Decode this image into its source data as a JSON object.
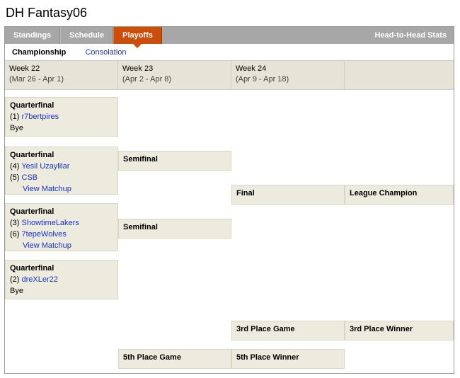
{
  "title": "DH Fantasy06",
  "topnav": {
    "standings": "Standings",
    "schedule": "Schedule",
    "playoffs": "Playoffs",
    "h2h": "Head-to-Head Stats"
  },
  "subnav": {
    "championship": "Championship",
    "consolation": "Consolation"
  },
  "weeks": {
    "w22_title": "Week 22",
    "w22_range": "(Mar 26 - Apr 1)",
    "w23_title": "Week 23",
    "w23_range": "(Apr 2 - Apr 8)",
    "w24_title": "Week 24",
    "w24_range": "(Apr 9 - Apr 18)"
  },
  "labels": {
    "quarterfinal": "Quarterfinal",
    "semifinal": "Semifinal",
    "final": "Final",
    "league_champion": "League Champion",
    "third_place_game": "3rd Place Game",
    "third_place_winner": "3rd Place Winner",
    "fifth_place_game": "5th Place Game",
    "fifth_place_winner": "5th Place Winner",
    "bye": "Bye",
    "view_matchup": "View Matchup"
  },
  "qf1": {
    "seed": "(1)",
    "team": "r7bertpires"
  },
  "qf2": {
    "seedA": "(4)",
    "teamA": "Yesil Uzaylilar",
    "seedB": "(5)",
    "teamB": "CSB"
  },
  "qf3": {
    "seedA": "(3)",
    "teamA": "ShowtimeLakers",
    "seedB": "(6)",
    "teamB": "7tepeWolves"
  },
  "qf4": {
    "seed": "(2)",
    "team": "dreXLer22"
  }
}
